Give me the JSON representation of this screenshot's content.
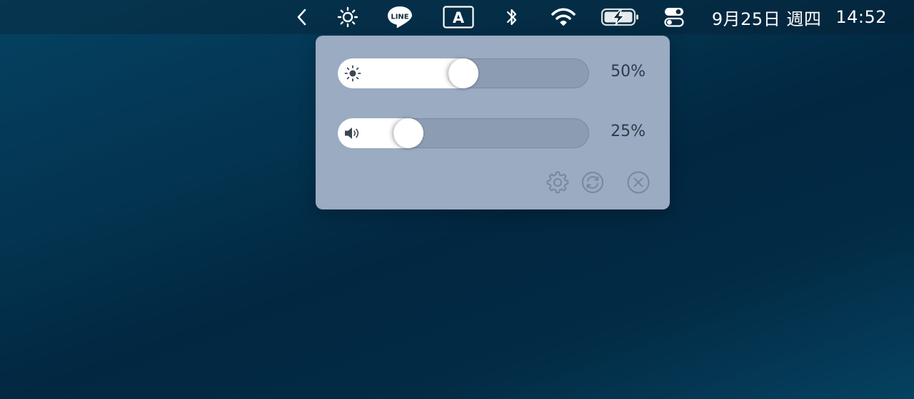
{
  "menubar": {
    "items": [
      {
        "name": "chevron-left-icon"
      },
      {
        "name": "brightness-icon"
      },
      {
        "name": "line-app-icon",
        "text": "LINE"
      },
      {
        "name": "input-source-icon",
        "text": "A"
      },
      {
        "name": "bluetooth-icon"
      },
      {
        "name": "wifi-icon"
      },
      {
        "name": "battery-charging-icon"
      },
      {
        "name": "control-center-icon"
      }
    ],
    "date": "9月25日 週四",
    "time": "14:52"
  },
  "panel": {
    "brightness": {
      "icon": "sun-icon",
      "level": 0.5,
      "label": "50%"
    },
    "volume": {
      "icon": "speaker-icon",
      "level": 0.25,
      "label": "25%"
    },
    "actions": [
      {
        "name": "settings-gear-icon"
      },
      {
        "name": "refresh-icon"
      },
      {
        "name": "close-icon"
      }
    ]
  },
  "colors": {
    "menubar_text": "#ffffff",
    "panel_bg": "#9aabc2",
    "track": "#8c9cb2",
    "fill": "#ffffff",
    "label": "#2f3b48",
    "action_icons": "#7a8898"
  }
}
